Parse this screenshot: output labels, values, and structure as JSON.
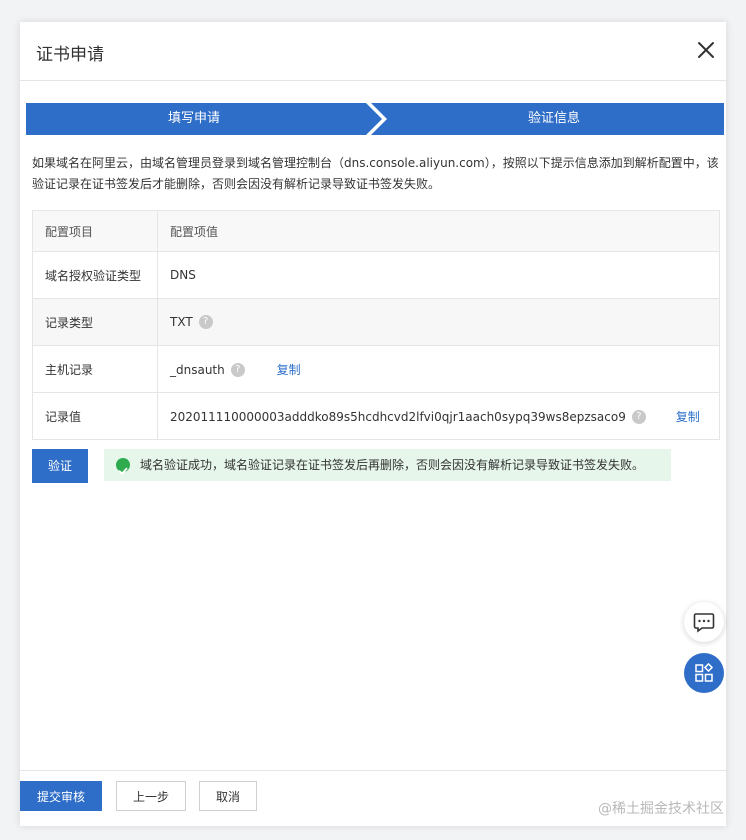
{
  "dialog": {
    "title": "证书申请"
  },
  "steps": [
    {
      "label": "填写申请"
    },
    {
      "label": "验证信息"
    }
  ],
  "intro_text": "如果域名在阿里云，由域名管理员登录到域名管理控制台（dns.console.aliyun.com），按照以下提示信息添加到解析配置中，该验证记录在证书签发后才能删除，否则会因没有解析记录导致证书签发失败。",
  "config_table": {
    "headers": [
      "配置项目",
      "配置项值"
    ],
    "rows": [
      {
        "label": "域名授权验证类型",
        "value": "DNS"
      },
      {
        "label": "记录类型",
        "value": "TXT"
      },
      {
        "label": "主机记录",
        "value": "_dnsauth",
        "action": "复制"
      },
      {
        "label": "记录值",
        "value": "202011110000003adddko89s5hcdhcvd2lfvi0qjr1aach0sypq39ws8epzsaco9",
        "action": "复制"
      }
    ]
  },
  "verify": {
    "button_label": "验证",
    "success_message": "域名验证成功，域名验证记录在证书签发后再删除，否则会因没有解析记录导致证书签发失败。"
  },
  "footer": {
    "submit_label": "提交审核",
    "prev_label": "上一步",
    "cancel_label": "取消"
  },
  "watermark": "@稀土掘金技术社区",
  "colors": {
    "primary": "#2f6ec8",
    "success_bg": "#e6f6ea",
    "success_icon": "#2eab4f",
    "link": "#2d6fc9"
  },
  "icons": {
    "close": "close-icon",
    "help": "question-icon",
    "success": "check-circle-icon",
    "chat": "chat-icon",
    "apps": "apps-icon"
  }
}
